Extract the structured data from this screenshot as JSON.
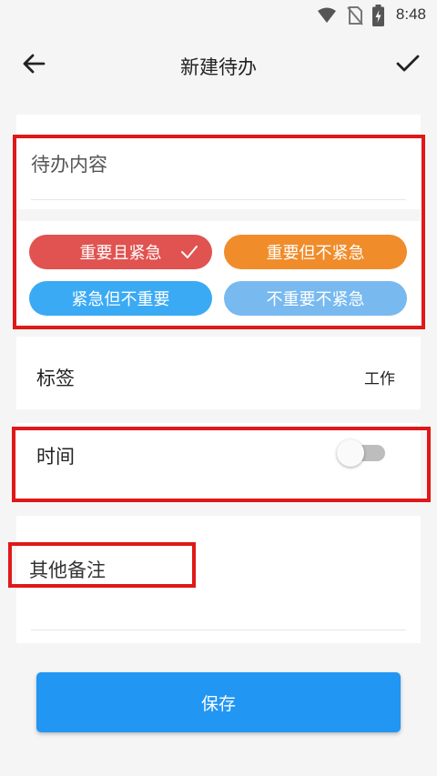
{
  "status_bar": {
    "time": "8:48"
  },
  "app_bar": {
    "title": "新建待办"
  },
  "content": {
    "placeholder": "待办内容"
  },
  "priority": {
    "options": [
      {
        "label": "重要且紧急",
        "color": "#e05350",
        "selected": true
      },
      {
        "label": "重要但不紧急",
        "color": "#f08c2a",
        "selected": false
      },
      {
        "label": "紧急但不重要",
        "color": "#3aaaf5",
        "selected": false
      },
      {
        "label": "不重要不紧急",
        "color": "#78b9f0",
        "selected": false
      }
    ]
  },
  "tag": {
    "label": "标签",
    "value": "工作"
  },
  "time": {
    "label": "时间",
    "enabled": false
  },
  "notes": {
    "label": "其他备注"
  },
  "actions": {
    "save_label": "保存"
  },
  "colors": {
    "accent": "#2196f3",
    "highlight": "#e01818"
  }
}
